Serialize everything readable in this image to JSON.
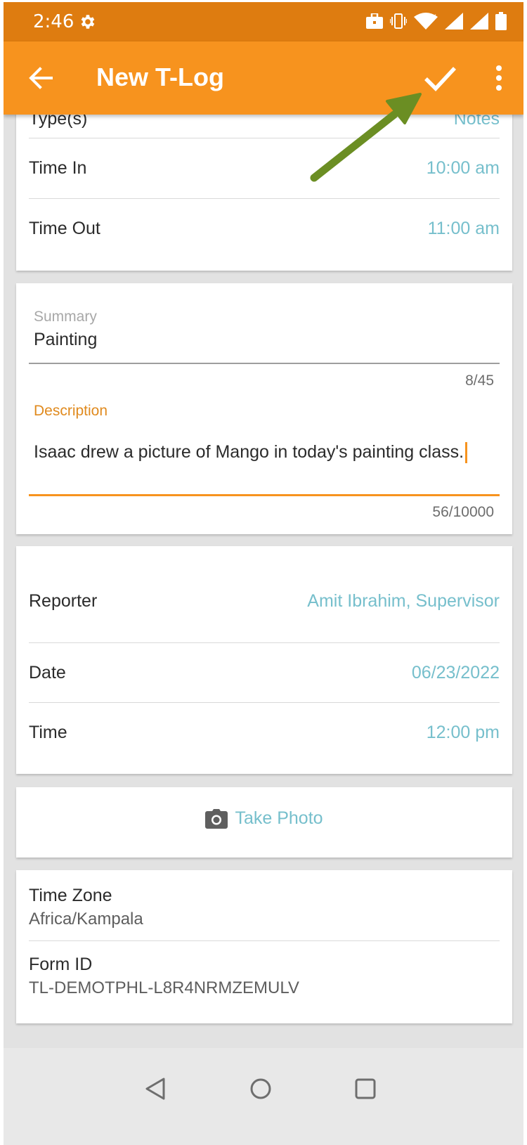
{
  "status_bar": {
    "time": "2:46",
    "icons": [
      "gear-icon",
      "briefcase-icon",
      "vibrate-icon",
      "wifi-icon",
      "signal-icon",
      "signal-icon",
      "battery-icon"
    ]
  },
  "app_bar": {
    "title": "New T-Log",
    "color": "#f7931e"
  },
  "details": {
    "partial_label": "Type(s)",
    "partial_value": "Notes",
    "time_in_label": "Time In",
    "time_in_value": "10:00 am",
    "time_out_label": "Time Out",
    "time_out_value": "11:00 am"
  },
  "summary": {
    "label": "Summary",
    "value": "Painting",
    "counter": "8/45"
  },
  "description": {
    "label": "Description",
    "value": "Isaac drew a picture of Mango in today's painting class.",
    "counter": "56/10000"
  },
  "report": {
    "reporter_label": "Reporter",
    "reporter_value": "Amit Ibrahim, Supervisor",
    "date_label": "Date",
    "date_value": "06/23/2022",
    "time_label": "Time",
    "time_value": "12:00 pm"
  },
  "photo": {
    "label": "Take Photo"
  },
  "info": {
    "timezone_label": "Time Zone",
    "timezone_value": "Africa/Kampala",
    "formid_label": "Form ID",
    "formid_value": "TL-DEMOTPHL-L8R4NRMZEMULV"
  },
  "colors": {
    "accent": "#f7931e",
    "status_bar": "#de7c10",
    "link": "#76bfcc",
    "annotation_arrow": "#6b8e23"
  }
}
